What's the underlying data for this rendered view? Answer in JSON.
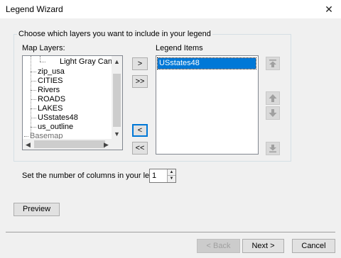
{
  "window": {
    "title": "Legend Wizard",
    "close_glyph": "✕"
  },
  "group": {
    "label": "Choose which layers you want to include in your legend"
  },
  "map_layers": {
    "label": "Map Layers:",
    "items": [
      {
        "label": "Light Gray Canvas",
        "indent": 2
      },
      {
        "label": "zip_usa",
        "indent": 1
      },
      {
        "label": "CITIES",
        "indent": 1
      },
      {
        "label": "Rivers",
        "indent": 1
      },
      {
        "label": "ROADS",
        "indent": 1
      },
      {
        "label": "LAKES",
        "indent": 1
      },
      {
        "label": "USstates48",
        "indent": 1
      },
      {
        "label": "us_outline",
        "indent": 1
      },
      {
        "label": "Basemap",
        "indent": 0
      }
    ]
  },
  "transfer_buttons": {
    "add": ">",
    "add_all": ">>",
    "remove": "<",
    "remove_all": "<<"
  },
  "legend_items": {
    "label": "Legend Items",
    "items": [
      {
        "label": "USstates48",
        "selected": true
      }
    ]
  },
  "order_buttons": [
    {
      "name": "move-to-top",
      "icon": "move-to-top-icon",
      "enabled": false
    },
    {
      "name": "move-up",
      "icon": "arrow-up-icon",
      "enabled": false
    },
    {
      "name": "move-down",
      "icon": "arrow-down-icon",
      "enabled": false
    },
    {
      "name": "move-to-bottom",
      "icon": "move-to-bottom-icon",
      "enabled": false
    }
  ],
  "columns": {
    "label": "Set the number of columns in your legend:",
    "value": "1"
  },
  "buttons": {
    "preview": "Preview",
    "back": "< Back",
    "next": "Next >",
    "cancel": "Cancel"
  }
}
